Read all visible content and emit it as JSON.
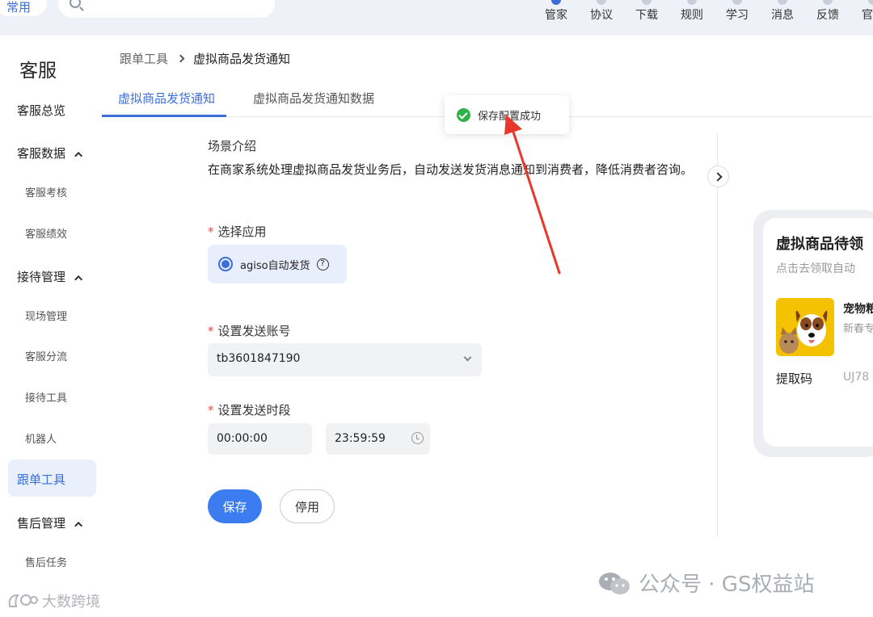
{
  "topbar": {
    "common_label": "常用",
    "nav": [
      "管家",
      "协议",
      "下载",
      "规则",
      "学习",
      "消息",
      "反馈",
      "官方"
    ]
  },
  "sidebar": {
    "title": "客服",
    "items": {
      "overview": "客服总览",
      "data_group": "客服数据",
      "assessment": "客服考核",
      "performance": "客服绩效",
      "reception_group": "接待管理",
      "onsite": "现场管理",
      "diversion": "客服分流",
      "tools": "接待工具",
      "robot": "机器人",
      "tracking": "跟单工具",
      "aftersale_group": "售后管理",
      "aftersale_task": "售后任务"
    }
  },
  "breadcrumb": {
    "parent": "跟单工具",
    "current": "虚拟商品发货通知"
  },
  "tabs": [
    "虚拟商品发货通知",
    "虚拟商品发货通知数据"
  ],
  "toast": {
    "message": "保存配置成功"
  },
  "form": {
    "scene_title": "场景介绍",
    "scene_desc": "在商家系统处理虚拟商品发货业务后，自动发送发货消息通知到消费者，降低消费者咨询。",
    "app_label": "选择应用",
    "app_value": "agiso自动发货",
    "account_label": "设置发送账号",
    "account_value": "tb3601847190",
    "period_label": "设置发送时段",
    "start_time": "00:00:00",
    "end_time": "23:59:59",
    "required_mark": "*",
    "save_label": "保存",
    "disable_label": "停用"
  },
  "preview": {
    "title": "虚拟商品待领",
    "subtitle": "点击去领取自动",
    "product_name": "宠物粮",
    "product_tag": "新春专",
    "code_label": "提取码",
    "code_value": "UJ78"
  },
  "watermarks": {
    "right": "公众号 · GS权益站",
    "left": "大数跨境"
  },
  "colors": {
    "accent": "#3b6fd8",
    "success": "#2fb14b",
    "annotation": "#e8372b"
  }
}
